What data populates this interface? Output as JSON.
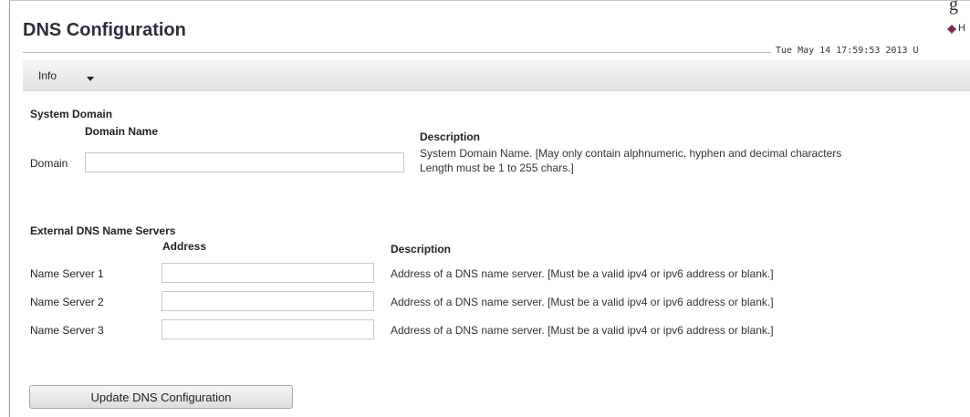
{
  "corner_fragment": "g",
  "header": {
    "title": "DNS Configuration",
    "help_label": "H",
    "timestamp": "Tue May 14 17:59:53 2013 U"
  },
  "menu": {
    "info_label": "Info"
  },
  "system_domain": {
    "section_title": "System Domain",
    "col_name": "Domain Name",
    "col_description": "Description",
    "field_label": "Domain",
    "field_value": "",
    "description_line1": "System Domain Name. [May only contain alphnumeric, hyphen and decimal characters",
    "description_line2": "Length must be 1 to 255 chars.]"
  },
  "external_dns": {
    "section_title": "External DNS Name Servers",
    "col_address": "Address",
    "col_description": "Description",
    "servers": [
      {
        "label": "Name Server 1",
        "value": "",
        "description": "Address of a DNS name server. [Must be a valid ipv4 or ipv6 address or blank.]"
      },
      {
        "label": "Name Server 2",
        "value": "",
        "description": "Address of a DNS name server. [Must be a valid ipv4 or ipv6 address or blank.]"
      },
      {
        "label": "Name Server 3",
        "value": "",
        "description": "Address of a DNS name server. [Must be a valid ipv4 or ipv6 address or blank.]"
      }
    ]
  },
  "actions": {
    "update_label": "Update DNS Configuration"
  }
}
